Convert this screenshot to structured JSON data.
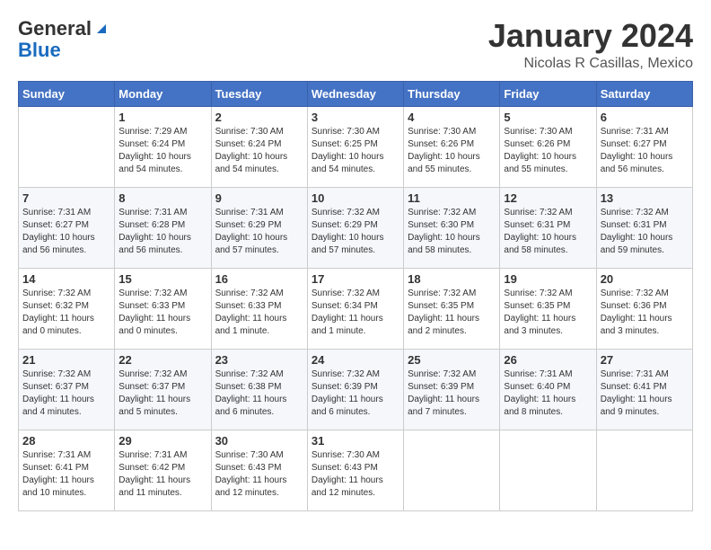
{
  "header": {
    "logo_general": "General",
    "logo_blue": "Blue",
    "month_title": "January 2024",
    "location": "Nicolas R Casillas, Mexico"
  },
  "days_of_week": [
    "Sunday",
    "Monday",
    "Tuesday",
    "Wednesday",
    "Thursday",
    "Friday",
    "Saturday"
  ],
  "weeks": [
    [
      {
        "day": "",
        "sunrise": "",
        "sunset": "",
        "daylight": ""
      },
      {
        "day": "1",
        "sunrise": "Sunrise: 7:29 AM",
        "sunset": "Sunset: 6:24 PM",
        "daylight": "Daylight: 10 hours and 54 minutes."
      },
      {
        "day": "2",
        "sunrise": "Sunrise: 7:30 AM",
        "sunset": "Sunset: 6:24 PM",
        "daylight": "Daylight: 10 hours and 54 minutes."
      },
      {
        "day": "3",
        "sunrise": "Sunrise: 7:30 AM",
        "sunset": "Sunset: 6:25 PM",
        "daylight": "Daylight: 10 hours and 54 minutes."
      },
      {
        "day": "4",
        "sunrise": "Sunrise: 7:30 AM",
        "sunset": "Sunset: 6:26 PM",
        "daylight": "Daylight: 10 hours and 55 minutes."
      },
      {
        "day": "5",
        "sunrise": "Sunrise: 7:30 AM",
        "sunset": "Sunset: 6:26 PM",
        "daylight": "Daylight: 10 hours and 55 minutes."
      },
      {
        "day": "6",
        "sunrise": "Sunrise: 7:31 AM",
        "sunset": "Sunset: 6:27 PM",
        "daylight": "Daylight: 10 hours and 56 minutes."
      }
    ],
    [
      {
        "day": "7",
        "sunrise": "Sunrise: 7:31 AM",
        "sunset": "Sunset: 6:27 PM",
        "daylight": "Daylight: 10 hours and 56 minutes."
      },
      {
        "day": "8",
        "sunrise": "Sunrise: 7:31 AM",
        "sunset": "Sunset: 6:28 PM",
        "daylight": "Daylight: 10 hours and 56 minutes."
      },
      {
        "day": "9",
        "sunrise": "Sunrise: 7:31 AM",
        "sunset": "Sunset: 6:29 PM",
        "daylight": "Daylight: 10 hours and 57 minutes."
      },
      {
        "day": "10",
        "sunrise": "Sunrise: 7:32 AM",
        "sunset": "Sunset: 6:29 PM",
        "daylight": "Daylight: 10 hours and 57 minutes."
      },
      {
        "day": "11",
        "sunrise": "Sunrise: 7:32 AM",
        "sunset": "Sunset: 6:30 PM",
        "daylight": "Daylight: 10 hours and 58 minutes."
      },
      {
        "day": "12",
        "sunrise": "Sunrise: 7:32 AM",
        "sunset": "Sunset: 6:31 PM",
        "daylight": "Daylight: 10 hours and 58 minutes."
      },
      {
        "day": "13",
        "sunrise": "Sunrise: 7:32 AM",
        "sunset": "Sunset: 6:31 PM",
        "daylight": "Daylight: 10 hours and 59 minutes."
      }
    ],
    [
      {
        "day": "14",
        "sunrise": "Sunrise: 7:32 AM",
        "sunset": "Sunset: 6:32 PM",
        "daylight": "Daylight: 11 hours and 0 minutes."
      },
      {
        "day": "15",
        "sunrise": "Sunrise: 7:32 AM",
        "sunset": "Sunset: 6:33 PM",
        "daylight": "Daylight: 11 hours and 0 minutes."
      },
      {
        "day": "16",
        "sunrise": "Sunrise: 7:32 AM",
        "sunset": "Sunset: 6:33 PM",
        "daylight": "Daylight: 11 hours and 1 minute."
      },
      {
        "day": "17",
        "sunrise": "Sunrise: 7:32 AM",
        "sunset": "Sunset: 6:34 PM",
        "daylight": "Daylight: 11 hours and 1 minute."
      },
      {
        "day": "18",
        "sunrise": "Sunrise: 7:32 AM",
        "sunset": "Sunset: 6:35 PM",
        "daylight": "Daylight: 11 hours and 2 minutes."
      },
      {
        "day": "19",
        "sunrise": "Sunrise: 7:32 AM",
        "sunset": "Sunset: 6:35 PM",
        "daylight": "Daylight: 11 hours and 3 minutes."
      },
      {
        "day": "20",
        "sunrise": "Sunrise: 7:32 AM",
        "sunset": "Sunset: 6:36 PM",
        "daylight": "Daylight: 11 hours and 3 minutes."
      }
    ],
    [
      {
        "day": "21",
        "sunrise": "Sunrise: 7:32 AM",
        "sunset": "Sunset: 6:37 PM",
        "daylight": "Daylight: 11 hours and 4 minutes."
      },
      {
        "day": "22",
        "sunrise": "Sunrise: 7:32 AM",
        "sunset": "Sunset: 6:37 PM",
        "daylight": "Daylight: 11 hours and 5 minutes."
      },
      {
        "day": "23",
        "sunrise": "Sunrise: 7:32 AM",
        "sunset": "Sunset: 6:38 PM",
        "daylight": "Daylight: 11 hours and 6 minutes."
      },
      {
        "day": "24",
        "sunrise": "Sunrise: 7:32 AM",
        "sunset": "Sunset: 6:39 PM",
        "daylight": "Daylight: 11 hours and 6 minutes."
      },
      {
        "day": "25",
        "sunrise": "Sunrise: 7:32 AM",
        "sunset": "Sunset: 6:39 PM",
        "daylight": "Daylight: 11 hours and 7 minutes."
      },
      {
        "day": "26",
        "sunrise": "Sunrise: 7:31 AM",
        "sunset": "Sunset: 6:40 PM",
        "daylight": "Daylight: 11 hours and 8 minutes."
      },
      {
        "day": "27",
        "sunrise": "Sunrise: 7:31 AM",
        "sunset": "Sunset: 6:41 PM",
        "daylight": "Daylight: 11 hours and 9 minutes."
      }
    ],
    [
      {
        "day": "28",
        "sunrise": "Sunrise: 7:31 AM",
        "sunset": "Sunset: 6:41 PM",
        "daylight": "Daylight: 11 hours and 10 minutes."
      },
      {
        "day": "29",
        "sunrise": "Sunrise: 7:31 AM",
        "sunset": "Sunset: 6:42 PM",
        "daylight": "Daylight: 11 hours and 11 minutes."
      },
      {
        "day": "30",
        "sunrise": "Sunrise: 7:30 AM",
        "sunset": "Sunset: 6:43 PM",
        "daylight": "Daylight: 11 hours and 12 minutes."
      },
      {
        "day": "31",
        "sunrise": "Sunrise: 7:30 AM",
        "sunset": "Sunset: 6:43 PM",
        "daylight": "Daylight: 11 hours and 12 minutes."
      },
      {
        "day": "",
        "sunrise": "",
        "sunset": "",
        "daylight": ""
      },
      {
        "day": "",
        "sunrise": "",
        "sunset": "",
        "daylight": ""
      },
      {
        "day": "",
        "sunrise": "",
        "sunset": "",
        "daylight": ""
      }
    ]
  ]
}
